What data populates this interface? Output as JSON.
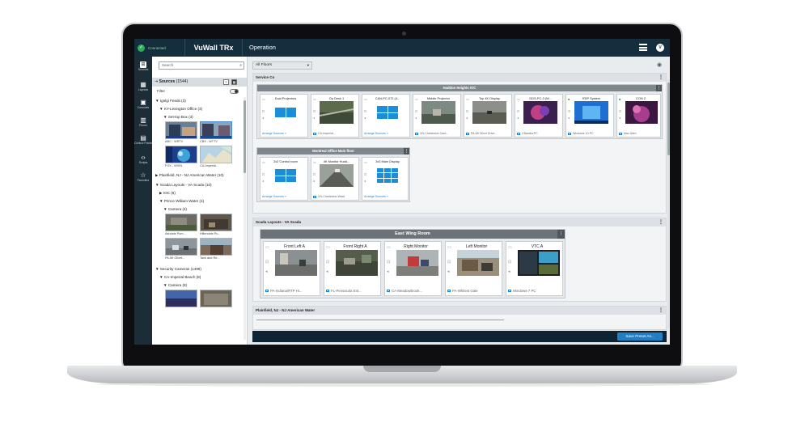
{
  "topbar": {
    "status_label": "Connected",
    "brand": "VuWall TRx",
    "mode": "Operation",
    "user_initial": "V"
  },
  "rail": [
    {
      "icon": "sources-icon",
      "glyph": "⊞",
      "label": "Sources"
    },
    {
      "icon": "layouts-icon",
      "glyph": "▦",
      "label": "Layouts"
    },
    {
      "icon": "consoles-icon",
      "glyph": "▣",
      "label": "Consoles"
    },
    {
      "icon": "floors-icon",
      "glyph": "▥",
      "label": "Floors"
    },
    {
      "icon": "control-points-icon",
      "glyph": "▤",
      "label": "Control Points"
    },
    {
      "icon": "scripts-icon",
      "glyph": "‹›",
      "label": "Scripts"
    },
    {
      "icon": "favorites-icon",
      "glyph": "☆",
      "label": "Favorites"
    }
  ],
  "sources_panel": {
    "search_placeholder": "Search",
    "header_label": "Sources",
    "header_count": "(1544)",
    "filter_label": "Filter",
    "tree": {
      "iptv": "▼ Igolgi Feeds (3)",
      "ky": "▼ KY-Lexington Office (3)",
      "settop": "▼ Set-top Box (3)",
      "plainfield": "▶ Plainfield, NJ - NJ American Water (10)",
      "scada": "▼ Scada Layouts - VA Scada (10)",
      "ioc": "▶ IOC (6)",
      "pw": "▼ Prince William Water (4)",
      "camera": "▼ Camera (4)",
      "security": "▼ Security Cameras (1499)",
      "imperial": "▼ CA-Imperial Beach (8)",
      "camera2": "▼ Camera (8)"
    },
    "thumbs": [
      "ABC - WRTV",
      "CBS - WTTV",
      "FOX - WXIN",
      "CA-Imperial...",
      "Ashdale Pum...",
      "Hillendale Pu...",
      "PA-Mt Olivet...",
      "Tank and Re..."
    ]
  },
  "main": {
    "floor_select": "All Floors",
    "sections": {
      "service": "Service Co",
      "scada": "Scada Layouts - VA Scada",
      "plainfield": "Plainfield, NJ - NJ American Water"
    },
    "walls": {
      "haddon": "Haddon Heights IOC",
      "montreal": "Montreal Office Main floor",
      "eastwing": "East Wing Room"
    },
    "haddon_tiles": [
      {
        "name": "Dual Projectors",
        "foot": "Arrange Sources »"
      },
      {
        "name": "Op Desk 1",
        "foot": "CA-Imperial..."
      },
      {
        "name": "CAN-PC-072 (4...",
        "foot": "Arrange Sources »"
      },
      {
        "name": "Middle Projector",
        "foot": "VN-Charleston Card..."
      },
      {
        "name": "Top 4K Display",
        "foot": "PA-Mt Olivet Drive..."
      },
      {
        "name": "GDS-PC-3 (W...",
        "foot": "CBastka-PC"
      },
      {
        "name": "RDP System",
        "foot": "Windows 10 PC"
      },
      {
        "name": "CON 2",
        "foot": "Mac Allen"
      }
    ],
    "montreal_tiles": [
      {
        "name": "2x2 Control room",
        "foot": "Arrange Sources »"
      },
      {
        "name": "4K Monitor Hudd...",
        "foot": "VN-Charleston Ward"
      },
      {
        "name": "3x3 Main Display",
        "foot": "Arrange Sources »"
      }
    ],
    "eastwing_tiles": [
      {
        "name": "Front Left A",
        "foot": "PA-Indiana/RTP Hi..."
      },
      {
        "name": "Front Right A",
        "foot": "FL-Pensacola Ent..."
      },
      {
        "name": "Right Monitor",
        "foot": "CA-Meadowbrook..."
      },
      {
        "name": "Left Monitor",
        "foot": "PA-Whitest Gate"
      },
      {
        "name": "VTC A",
        "foot": "Windows-7 PC"
      }
    ],
    "save_button": "Save Preset As..."
  }
}
